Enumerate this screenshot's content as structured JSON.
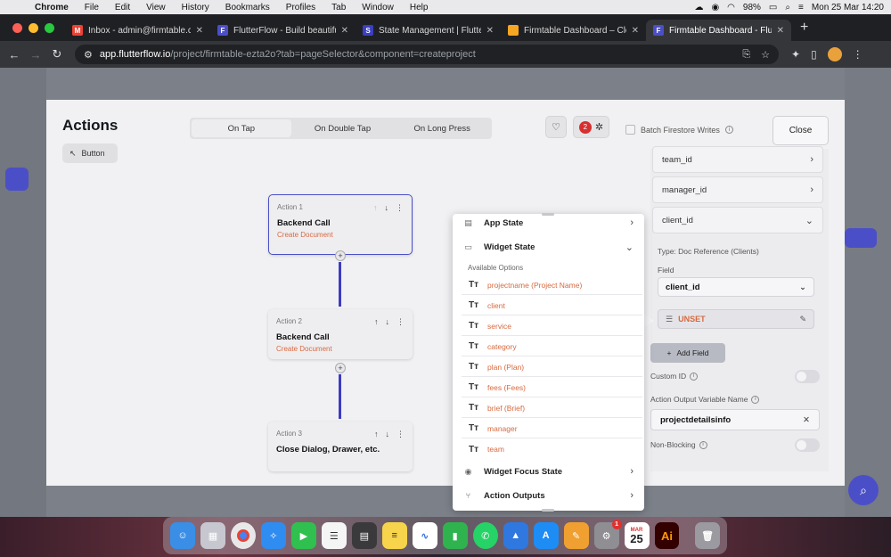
{
  "menubar": {
    "app": "Chrome",
    "items": [
      "File",
      "Edit",
      "View",
      "History",
      "Bookmarks",
      "Profiles",
      "Tab",
      "Window",
      "Help"
    ],
    "battery": "98%",
    "clock": "Mon 25 Mar  14:20"
  },
  "tabs": [
    {
      "label": "Inbox - admin@firmtable.com",
      "icon": "gmail-icon",
      "color": "#ea4335",
      "glyph": "M"
    },
    {
      "label": "FlutterFlow - Build beautiful, m",
      "icon": "flutterflow-icon",
      "color": "#4b4fc7",
      "glyph": "F"
    },
    {
      "label": "State Management | FlutterFlo",
      "icon": "flutterflow-docs-icon",
      "color": "#3b3fc1",
      "glyph": "S"
    },
    {
      "label": "Firmtable Dashboard – Cloud",
      "icon": "firebase-icon",
      "color": "#f5a623",
      "glyph": "🔥"
    },
    {
      "label": "Firmtable Dashboard - Flutte",
      "icon": "flutterflow-icon",
      "color": "#4b4fc7",
      "glyph": "F"
    }
  ],
  "address": {
    "host": "app.flutterflow.io",
    "path": "/project/firmtable-ezta2o?tab=pageSelector&component=createproject"
  },
  "modal": {
    "title": "Actions",
    "trigger_tag": "Button",
    "trigger_tabs": [
      "On Tap",
      "On Double Tap",
      "On Long Press"
    ],
    "error_count": "2",
    "batch_label": "Batch Firestore Writes",
    "close_label": "Close"
  },
  "actions": [
    {
      "num": "Action 1",
      "title": "Backend Call",
      "sub": "Create Document"
    },
    {
      "num": "Action 2",
      "title": "Backend Call",
      "sub": "Create Document"
    },
    {
      "num": "Action 3",
      "title": "Close Dialog, Drawer, etc.",
      "sub": ""
    }
  ],
  "rpanel": {
    "fields": [
      "team_id",
      "manager_id",
      "client_id"
    ],
    "type_label": "Type: Doc Reference (Clients)",
    "field_label": "Field",
    "field_value": "client_id",
    "unset_label": "UNSET",
    "add_field_label": "Add Field",
    "custom_id_label": "Custom ID",
    "output_var_label": "Action Output Variable Name",
    "output_var_value": "projectdetailsinfo",
    "non_blocking_label": "Non-Blocking"
  },
  "popup": {
    "app_state": "App State",
    "widget_state": "Widget State",
    "available": "Available Options",
    "options": [
      "projectname (Project Name)",
      "client",
      "service",
      "category",
      "plan (Plan)",
      "fees (Fees)",
      "brief (Brief)",
      "manager",
      "team"
    ],
    "widget_focus_state": "Widget Focus State",
    "action_outputs": "Action Outputs",
    "type_glyph": "Tт"
  },
  "dock": {
    "calendar_month": "MAR",
    "calendar_day": "25",
    "settings_badge": "1",
    "illustrator_label": "Ai"
  }
}
